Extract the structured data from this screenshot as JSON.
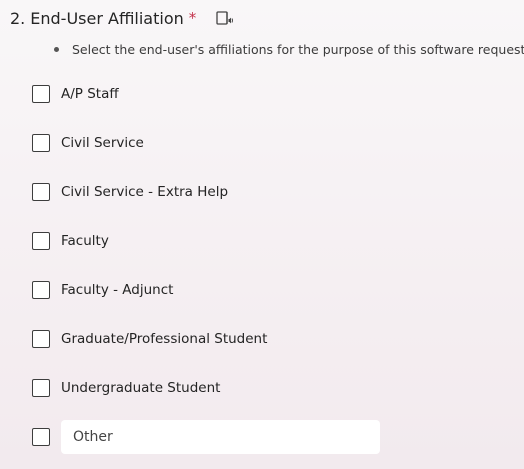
{
  "question": {
    "number": "2.",
    "title": "End-User Affiliation",
    "required_marker": "*",
    "reader_icon": "immersive-reader-icon",
    "subtitle": "Select the end-user's affiliations for the purpose of this software request."
  },
  "options": [
    {
      "label": "A/P Staff"
    },
    {
      "label": "Civil Service"
    },
    {
      "label": "Civil Service - Extra Help"
    },
    {
      "label": "Faculty"
    },
    {
      "label": "Faculty - Adjunct"
    },
    {
      "label": "Graduate/Professional Student"
    },
    {
      "label": "Undergraduate Student"
    }
  ],
  "other": {
    "placeholder": "Other",
    "value": ""
  },
  "colors": {
    "required": "#c4314b",
    "text": "#242424",
    "checkbox_border": "#3d3d3d"
  }
}
